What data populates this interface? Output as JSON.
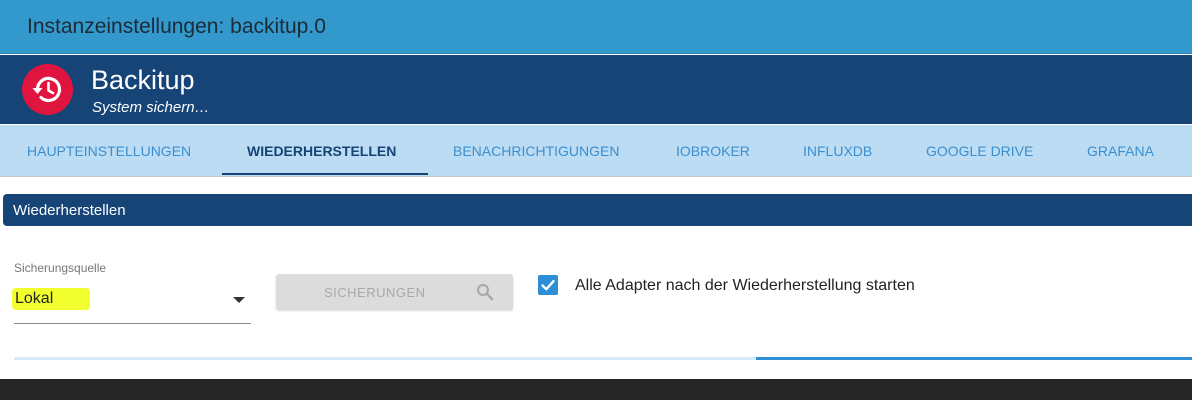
{
  "window": {
    "title": "Instanzeinstellungen: backitup.0"
  },
  "header": {
    "app_name": "Backitup",
    "subtitle": "System sichern…",
    "logo_icon": "restore-clock-icon"
  },
  "tabs": [
    {
      "label": "HAUPTEINSTELLUNGEN",
      "active": false
    },
    {
      "label": "WIEDERHERSTELLEN",
      "active": true
    },
    {
      "label": "BENACHRICHTIGUNGEN",
      "active": false
    },
    {
      "label": "IOBROKER",
      "active": false
    },
    {
      "label": "INFLUXDB",
      "active": false
    },
    {
      "label": "GOOGLE DRIVE",
      "active": false,
      "highlighted": true
    },
    {
      "label": "GRAFANA",
      "active": false
    }
  ],
  "section": {
    "title": "Wiederherstellen"
  },
  "restore": {
    "source_label": "Sicherungsquelle",
    "source_value": "Lokal",
    "backups_button_label": "SICHERUNGEN",
    "backups_button_enabled": false,
    "start_adapters_label": "Alle Adapter nach der Wiederherstellung starten",
    "start_adapters_checked": true
  },
  "colors": {
    "titlebar": "#3399cc",
    "header": "#164477",
    "tabbar": "#bcdcf4",
    "accent": "#2f8fd6",
    "logo_red": "#e0153f",
    "highlight": "#e9fb2c"
  }
}
